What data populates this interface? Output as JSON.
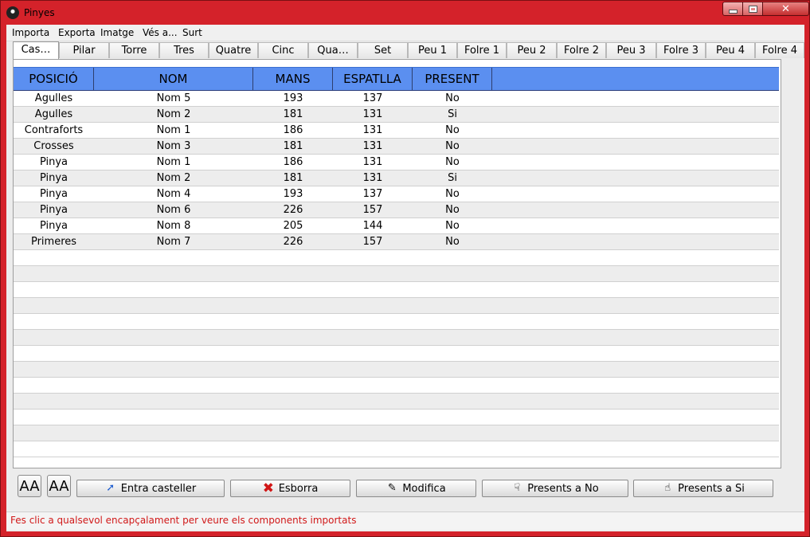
{
  "window": {
    "title": "Pinyes",
    "controls": {
      "minimize": "minimize",
      "maximize": "maximize",
      "close": "✕"
    }
  },
  "menu": [
    "Importa",
    "Exporta",
    "Imatge",
    "Vés a...",
    "Surt"
  ],
  "tabs": [
    "Cas…",
    "Pilar",
    "Torre",
    "Tres",
    "Quatre",
    "Cinc",
    "Qua…",
    "Set",
    "Peu 1",
    "Folre 1",
    "Peu 2",
    "Folre 2",
    "Peu 3",
    "Folre 3",
    "Peu 4",
    "Folre 4"
  ],
  "active_tab": "Cas…",
  "table": {
    "headers": [
      "POSICIÓ",
      "NOM",
      "MANS",
      "ESPATLLA",
      "PRESENT"
    ],
    "rows": [
      [
        "Agulles",
        "Nom 5",
        "193",
        "137",
        "No"
      ],
      [
        "Agulles",
        "Nom 2",
        "181",
        "131",
        "Si"
      ],
      [
        "Contraforts",
        "Nom 1",
        "186",
        "131",
        "No"
      ],
      [
        "Crosses",
        "Nom 3",
        "181",
        "131",
        "No"
      ],
      [
        "Pinya",
        "Nom 1",
        "186",
        "131",
        "No"
      ],
      [
        "Pinya",
        "Nom 2",
        "181",
        "131",
        "Si"
      ],
      [
        "Pinya",
        "Nom 4",
        "193",
        "137",
        "No"
      ],
      [
        "Pinya",
        "Nom 6",
        "226",
        "157",
        "No"
      ],
      [
        "Pinya",
        "Nom 8",
        "205",
        "144",
        "No"
      ],
      [
        "Primeres",
        "Nom 7",
        "226",
        "157",
        "No"
      ]
    ],
    "header_color": "#5b8ff0"
  },
  "toolbar": {
    "font_increase": "AA",
    "font_decrease": "AA",
    "add": "Entra casteller",
    "delete": "Esborra",
    "edit": "Modifica",
    "set_absent": "Presents a No",
    "set_present": "Presents a Si"
  },
  "icons": {
    "add": "arrow-icon",
    "delete": "x-icon",
    "edit": "edit-icon",
    "set_absent": "thumbs-down-icon",
    "set_present": "thumbs-up-icon"
  },
  "status": "Fes clic a qualsevol encapçalament per veure els components importats",
  "colors": {
    "window_frame": "#d4222a",
    "status_text": "#d11919"
  }
}
